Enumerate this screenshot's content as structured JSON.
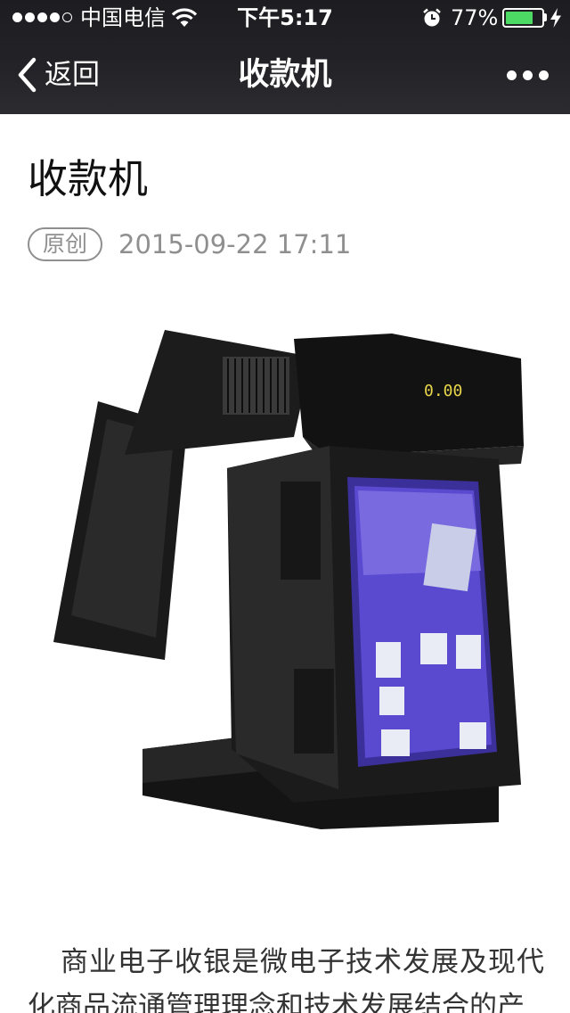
{
  "status_bar": {
    "carrier": "中国电信",
    "time": "下午5:17",
    "battery_percent": "77%",
    "battery_level": 0.77,
    "signal_bars_filled": 4,
    "signal_bars_total": 5,
    "battery_color": "#4cd964"
  },
  "nav": {
    "back_label": "返回",
    "title": "收款机",
    "more_icon": "more-dots-icon"
  },
  "article": {
    "title": "收款机",
    "badge": "原创",
    "date": "2015-09-22 17:11",
    "image_screen_text": "0.00",
    "paragraph": "商业电子收银是微电子技术发展及现代化商品流通管理理念和技术发展结合的产"
  }
}
